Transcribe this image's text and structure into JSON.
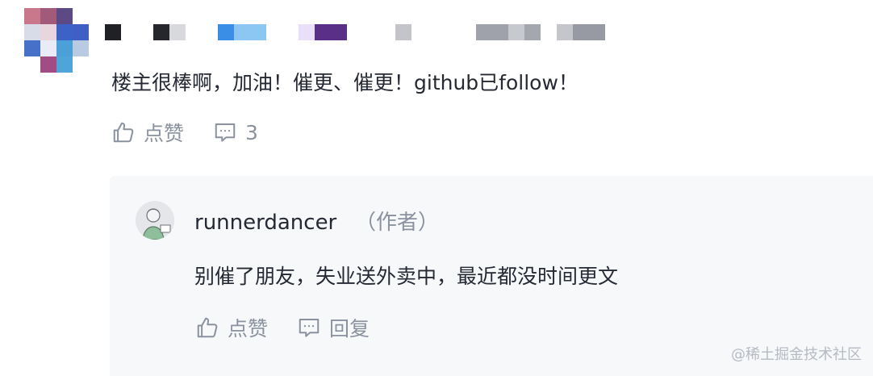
{
  "comment": {
    "text": "楼主很棒啊，加油！催更、催更！github已follow！",
    "like_label": "点赞",
    "reply_count": "3"
  },
  "reply": {
    "author": "runnerdancer",
    "author_tag": "（作者）",
    "text": "别催了朋友，失业送外卖中，最近都没时间更文",
    "like_label": "点赞",
    "reply_label": "回复"
  },
  "watermark": "@稀土掘金技术社区",
  "colors": {
    "text_primary": "#252933",
    "text_secondary": "#8a919f",
    "reply_background": "#f7f8fa"
  },
  "icons": {
    "like": "thumbs-up-icon",
    "comment": "comment-bubble-icon"
  }
}
